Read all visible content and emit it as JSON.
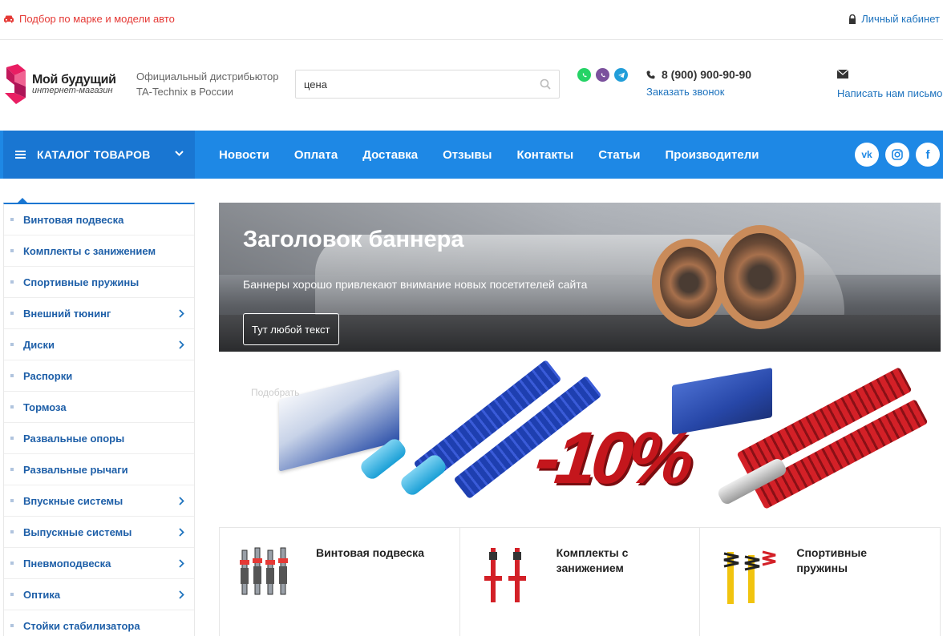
{
  "topbar": {
    "car_selector": "Подбор по марке и модели авто",
    "account": "Личный кабинет"
  },
  "header": {
    "logo_line1": "Мой будущий",
    "logo_line2": "интернет-магазин",
    "distributor": "Официальный дистрибьютор TA-Technix в России",
    "search_value": "цена",
    "phone": "8 (900) 900-90-90",
    "callback": "Заказать звонок",
    "write_letter": "Написать нам письмо"
  },
  "nav": {
    "catalog": "КАТАЛОГ ТОВАРОВ",
    "links": [
      "Новости",
      "Оплата",
      "Доставка",
      "Отзывы",
      "Контакты",
      "Статьи",
      "Производители"
    ],
    "social": [
      "vk",
      "ig",
      "f"
    ]
  },
  "sidebar": {
    "items": [
      {
        "label": "Винтовая подвеска",
        "has_sub": false
      },
      {
        "label": "Комплекты с занижением",
        "has_sub": false
      },
      {
        "label": "Спортивные пружины",
        "has_sub": false
      },
      {
        "label": "Внешний тюнинг",
        "has_sub": true
      },
      {
        "label": "Диски",
        "has_sub": true
      },
      {
        "label": "Распорки",
        "has_sub": false
      },
      {
        "label": "Тормоза",
        "has_sub": false
      },
      {
        "label": "Развальные опоры",
        "has_sub": false
      },
      {
        "label": "Развальные рычаги",
        "has_sub": false
      },
      {
        "label": "Впускные системы",
        "has_sub": true
      },
      {
        "label": "Выпускные системы",
        "has_sub": true
      },
      {
        "label": "Пневмоподвеска",
        "has_sub": true
      },
      {
        "label": "Оптика",
        "has_sub": true
      },
      {
        "label": "Стойки стабилизатора",
        "has_sub": false
      }
    ]
  },
  "banner": {
    "title": "Заголовок баннера",
    "subtitle": "Баннеры хорошо привлекают внимание новых посетителей сайта",
    "button": "Тут любой текст"
  },
  "promo": {
    "ghost_text": "Подобрать",
    "discount": "-10%"
  },
  "cards": [
    {
      "name": "Винтовая подвеска"
    },
    {
      "name": "Комплекты с занижением"
    },
    {
      "name": "Спортивные пружины"
    }
  ],
  "colors": {
    "accent": "#1e88e5",
    "accent_dark": "#1976d2",
    "link": "#1e73be",
    "red": "#e53935"
  }
}
